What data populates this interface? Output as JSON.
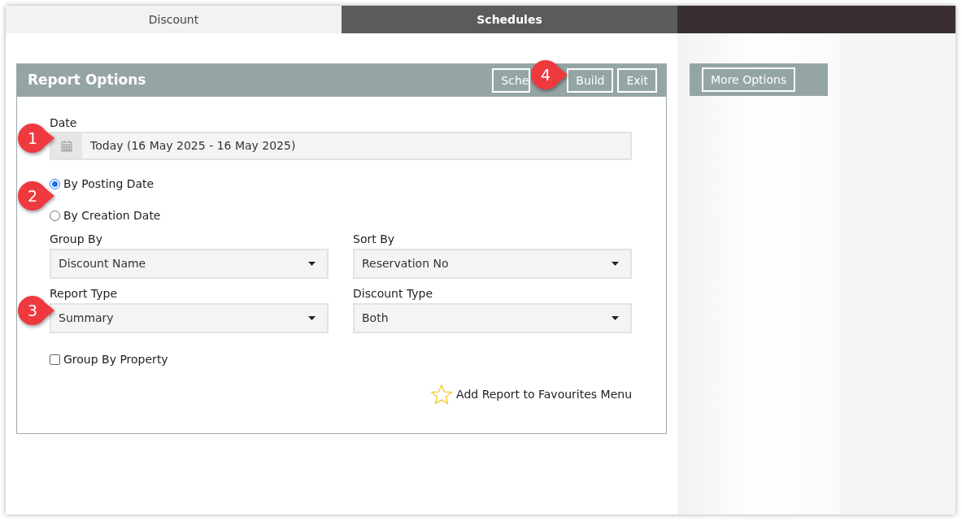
{
  "tabs": [
    {
      "label": "Discount",
      "selected": false
    },
    {
      "label": "Schedules",
      "selected": true
    }
  ],
  "panel": {
    "title": "Report Options",
    "buttons": [
      "Sche",
      "Build",
      "Exit"
    ]
  },
  "date": {
    "label": "Date",
    "value": "Today (16 May 2025 - 16 May 2025)"
  },
  "date_basis": [
    {
      "label": "By Posting Date",
      "selected": true
    },
    {
      "label": "By Creation Date",
      "selected": false
    }
  ],
  "selects": [
    {
      "label": "Group By",
      "value": "Discount Name"
    },
    {
      "label": "Sort By",
      "value": "Reservation No"
    },
    {
      "label": "Report Type",
      "value": "Summary"
    },
    {
      "label": "Discount Type",
      "value": "Both"
    }
  ],
  "group_by_property": {
    "label": "Group By Property",
    "checked": false
  },
  "favourites_link": "Add Report to Favourites Menu",
  "more_options": "More Options",
  "callouts": [
    "1",
    "2",
    "3",
    "4"
  ]
}
